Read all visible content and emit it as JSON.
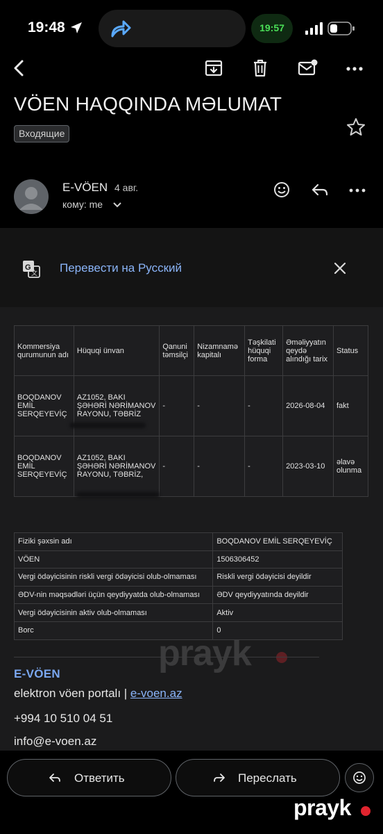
{
  "status_bar": {
    "time": "19:48",
    "clock_pill": "19:57"
  },
  "email": {
    "subject": "VÖEN HAQQINDA MƏLUMAT",
    "label": "Входящие",
    "sender": "E-VÖEN",
    "date": "4 авг.",
    "to": "кому: me"
  },
  "translate": {
    "text": "Перевести на Русский"
  },
  "table1": {
    "headers": [
      "Kommersiya qurumunun adı",
      "Hüquqi ünvan",
      "Qanuni təmsilçi",
      "Nizamnamə kapitalı",
      "Təşkilati hüquqi forma",
      "Əməliyyatın qeydə alındığı tarix",
      "Status"
    ],
    "rows": [
      [
        "BOQDANOV EMİL SERQEYEVİÇ",
        "AZ1052, BAKI ŞƏHƏRİ NƏRİMANOV RAYONU, TƏBRİZ",
        "-",
        "-",
        "-",
        "2026-08-04",
        "fakt"
      ],
      [
        "BOQDANOV EMİL SERQEYEVİÇ",
        "AZ1052, BAKI ŞƏHƏRİ NƏRİMANOV RAYONU, TƏBRİZ,",
        "-",
        "-",
        "-",
        "2023-03-10",
        "əlavə olunma"
      ]
    ]
  },
  "table2": {
    "rows": [
      [
        "Fiziki şəxsin adı",
        "BOQDANOV EMİL SERQEYEVİÇ"
      ],
      [
        "VÖEN",
        "1506306452"
      ],
      [
        "Vergi ödəyicisinin riskli vergi ödəyicisi olub-olmaması",
        "Riskli vergi ödəyicisi deyildir"
      ],
      [
        "ƏDV-nin məqsədləri üçün qeydiyyatda olub-olmaması",
        "ƏDV qeydiyyatında deyildir"
      ],
      [
        "Vergi ödəyicisinin aktiv olub-olmaması",
        "Aktiv"
      ],
      [
        "Borc",
        "0"
      ]
    ]
  },
  "footer": {
    "title": "E-VÖEN",
    "portal_text": "elektron vöen portalı | ",
    "portal_link": "e-voen.az",
    "phone": "+994 10 510 04 51",
    "email": "info@e-voen.az"
  },
  "actions": {
    "reply": "Ответить",
    "forward": "Переслать"
  },
  "watermark": "prayk",
  "colors": {
    "link": "#8ab4f8",
    "brand_title": "#7aa7f0",
    "watermark_dot": "#e0242e"
  }
}
